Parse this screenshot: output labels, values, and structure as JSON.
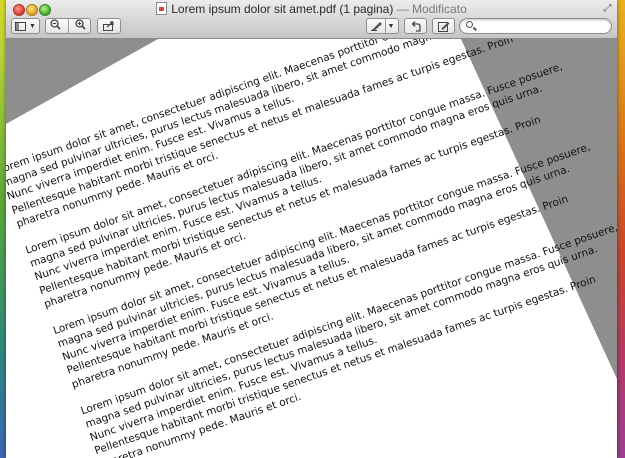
{
  "window": {
    "title": "Lorem ipsum dolor sit amet.pdf (1 pagina)",
    "separator": "—",
    "status": "Modificato"
  },
  "toolbar": {
    "sidebar_icon": "sidebar-icon",
    "zoom_out_icon": "zoom-out-icon",
    "zoom_in_icon": "zoom-in-icon",
    "share_icon": "share-icon",
    "annotate_icon": "pen-icon",
    "rotate_icon": "rotate-icon",
    "edit_icon": "edit-icon",
    "search": {
      "placeholder": "",
      "value": ""
    }
  },
  "document": {
    "paragraphs": [
      [
        "Lorem ipsum dolor sit amet, consectetuer adipiscing elit. Maecenas porttitor congue massa. Fusce posuere,",
        "magna sed pulvinar ultricies, purus lectus malesuada libero, sit amet commodo magna eros quis urna.",
        "Nunc viverra imperdiet enim. Fusce est. Vivamus a tellus.",
        "Pellentesque habitant morbi tristique senectus et netus et malesuada fames ac turpis egestas. Proin",
        "pharetra nonummy pede. Mauris et orci."
      ],
      [
        "Lorem ipsum dolor sit amet, consectetuer adipiscing elit. Maecenas porttitor congue massa. Fusce posuere,",
        "magna sed pulvinar ultricies, purus lectus malesuada libero, sit amet commodo magna eros quis urna.",
        "Nunc viverra imperdiet enim. Fusce est. Vivamus a tellus.",
        "Pellentesque habitant morbi tristique senectus et netus et malesuada fames ac turpis egestas. Proin",
        "pharetra nonummy pede. Mauris et orci."
      ],
      [
        "Lorem ipsum dolor sit amet, consectetuer adipiscing elit. Maecenas porttitor congue massa. Fusce posuere,",
        "magna sed pulvinar ultricies, purus lectus malesuada libero, sit amet commodo magna eros quis urna.",
        "Nunc viverra imperdiet enim. Fusce est. Vivamus a tellus.",
        "Pellentesque habitant morbi tristique senectus et netus et malesuada fames ac turpis egestas. Proin",
        "pharetra nonummy pede. Mauris et orci."
      ],
      [
        "Lorem ipsum dolor sit amet, consectetuer adipiscing elit. Maecenas porttitor congue massa. Fusce posuere,",
        "magna sed pulvinar ultricies, purus lectus malesuada libero, sit amet commodo magna eros quis urna.",
        "Nunc viverra imperdiet enim. Fusce est. Vivamus a tellus.",
        "Pellentesque habitant morbi tristique senectus et netus et malesuada fames ac turpis egestas. Proin",
        "pharetra nonummy pede. Mauris et orci."
      ]
    ]
  },
  "colors": {
    "viewer_background": "#8e8e8e",
    "page": "#ffffff",
    "text": "#111111"
  }
}
